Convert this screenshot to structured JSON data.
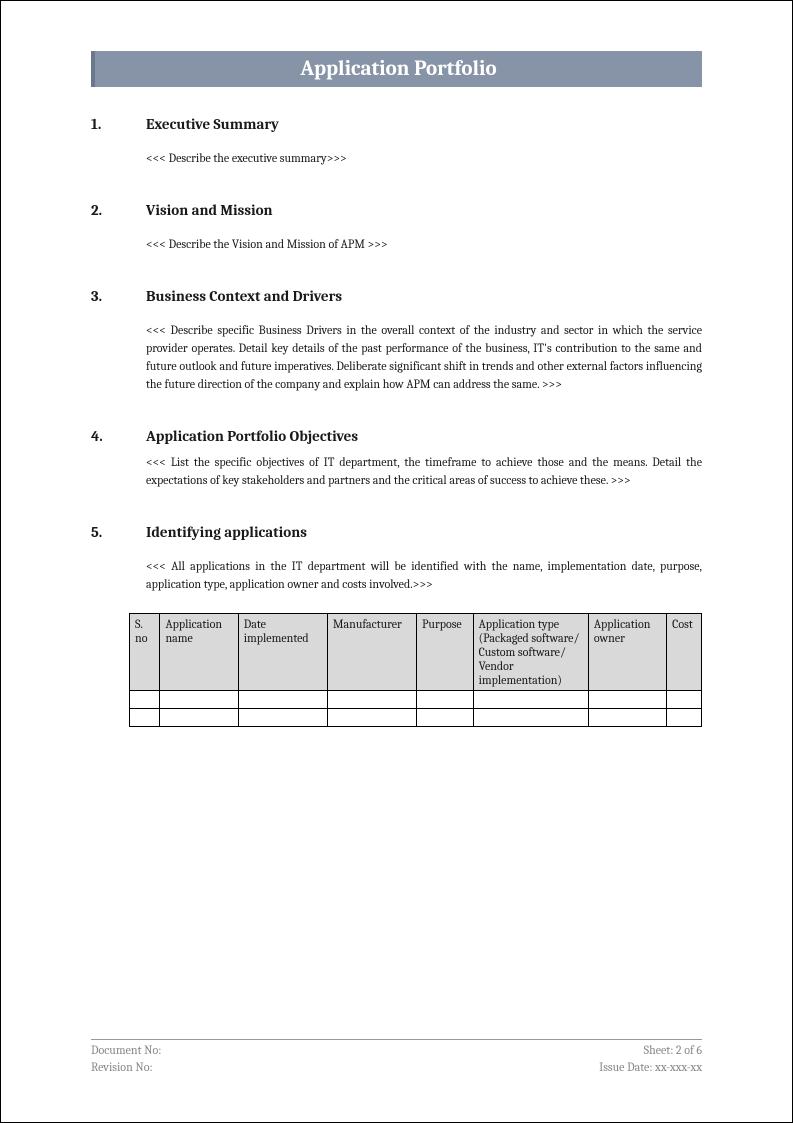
{
  "title": "Application Portfolio",
  "sections": [
    {
      "num": "1.",
      "heading": "Executive Summary",
      "body": "<<< Describe the executive summary>>>"
    },
    {
      "num": "2.",
      "heading": "Vision and Mission",
      "body": "<<< Describe the Vision and Mission of APM >>>"
    },
    {
      "num": "3.",
      "heading": "Business Context and Drivers",
      "body": "<<< Describe specific Business Drivers in the overall context of the industry and sector in which the service provider operates. Detail key details of the past performance of the business, IT's contribution to the same and future outlook and future imperatives. Deliberate significant shift in trends and other external factors influencing the future direction of the company and explain how APM can address the same. >>>"
    },
    {
      "num": "4.",
      "heading": "Application Portfolio Objectives",
      "body": "<<< List the specific objectives of IT department, the timeframe to achieve those and the means. Detail the expectations of key stakeholders and partners and the critical areas of success to achieve these. >>>"
    },
    {
      "num": "5.",
      "heading": "Identifying applications",
      "body": "<<< All applications in the IT department will be identified with the name, implementation date, purpose, application type, application owner and costs involved.>>>"
    }
  ],
  "table": {
    "headers": [
      "S. no",
      "Application name",
      "Date implemented",
      "Manufacturer",
      "Purpose",
      "Application type (Packaged software/ Custom software/ Vendor implementation)",
      "Application owner",
      "Cost"
    ]
  },
  "footer": {
    "doc_no_label": "Document No:",
    "rev_no_label": "Revision No:",
    "sheet": "Sheet: 2 of 6",
    "issue_date": "Issue Date: xx-xxx-xx"
  }
}
